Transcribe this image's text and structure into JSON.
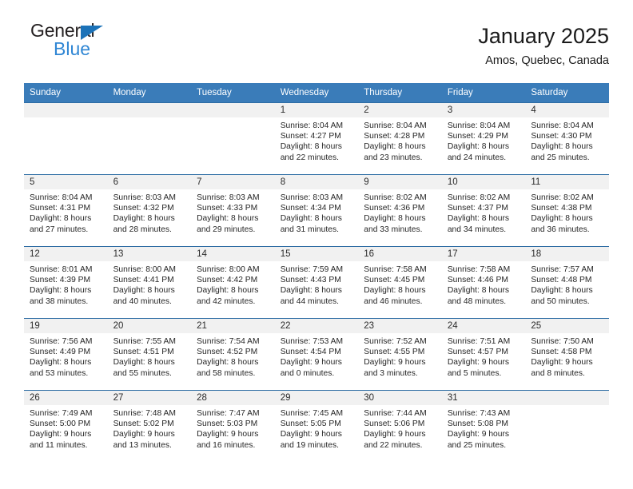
{
  "brand": {
    "name_top": "General",
    "name_bottom": "Blue",
    "triangle_color": "#1b72b8",
    "blue_text_color": "#2f86d4"
  },
  "header": {
    "title": "January 2025",
    "location": "Amos, Quebec, Canada"
  },
  "theme": {
    "header_bar_color": "#3a7cb9",
    "row_rule_color": "#2e6da4",
    "daystrip_color": "#f1f1f1"
  },
  "calendar": {
    "weekday_headers": [
      "Sunday",
      "Monday",
      "Tuesday",
      "Wednesday",
      "Thursday",
      "Friday",
      "Saturday"
    ],
    "labels": {
      "sunrise": "Sunrise:",
      "sunset": "Sunset:",
      "daylight": "Daylight:"
    },
    "weeks": [
      [
        {
          "blank": true
        },
        {
          "blank": true
        },
        {
          "blank": true
        },
        {
          "day": "1",
          "sunrise": "Sunrise: 8:04 AM",
          "sunset": "Sunset: 4:27 PM",
          "daylight_l1": "Daylight: 8 hours",
          "daylight_l2": "and 22 minutes."
        },
        {
          "day": "2",
          "sunrise": "Sunrise: 8:04 AM",
          "sunset": "Sunset: 4:28 PM",
          "daylight_l1": "Daylight: 8 hours",
          "daylight_l2": "and 23 minutes."
        },
        {
          "day": "3",
          "sunrise": "Sunrise: 8:04 AM",
          "sunset": "Sunset: 4:29 PM",
          "daylight_l1": "Daylight: 8 hours",
          "daylight_l2": "and 24 minutes."
        },
        {
          "day": "4",
          "sunrise": "Sunrise: 8:04 AM",
          "sunset": "Sunset: 4:30 PM",
          "daylight_l1": "Daylight: 8 hours",
          "daylight_l2": "and 25 minutes."
        }
      ],
      [
        {
          "day": "5",
          "sunrise": "Sunrise: 8:04 AM",
          "sunset": "Sunset: 4:31 PM",
          "daylight_l1": "Daylight: 8 hours",
          "daylight_l2": "and 27 minutes."
        },
        {
          "day": "6",
          "sunrise": "Sunrise: 8:03 AM",
          "sunset": "Sunset: 4:32 PM",
          "daylight_l1": "Daylight: 8 hours",
          "daylight_l2": "and 28 minutes."
        },
        {
          "day": "7",
          "sunrise": "Sunrise: 8:03 AM",
          "sunset": "Sunset: 4:33 PM",
          "daylight_l1": "Daylight: 8 hours",
          "daylight_l2": "and 29 minutes."
        },
        {
          "day": "8",
          "sunrise": "Sunrise: 8:03 AM",
          "sunset": "Sunset: 4:34 PM",
          "daylight_l1": "Daylight: 8 hours",
          "daylight_l2": "and 31 minutes."
        },
        {
          "day": "9",
          "sunrise": "Sunrise: 8:02 AM",
          "sunset": "Sunset: 4:36 PM",
          "daylight_l1": "Daylight: 8 hours",
          "daylight_l2": "and 33 minutes."
        },
        {
          "day": "10",
          "sunrise": "Sunrise: 8:02 AM",
          "sunset": "Sunset: 4:37 PM",
          "daylight_l1": "Daylight: 8 hours",
          "daylight_l2": "and 34 minutes."
        },
        {
          "day": "11",
          "sunrise": "Sunrise: 8:02 AM",
          "sunset": "Sunset: 4:38 PM",
          "daylight_l1": "Daylight: 8 hours",
          "daylight_l2": "and 36 minutes."
        }
      ],
      [
        {
          "day": "12",
          "sunrise": "Sunrise: 8:01 AM",
          "sunset": "Sunset: 4:39 PM",
          "daylight_l1": "Daylight: 8 hours",
          "daylight_l2": "and 38 minutes."
        },
        {
          "day": "13",
          "sunrise": "Sunrise: 8:00 AM",
          "sunset": "Sunset: 4:41 PM",
          "daylight_l1": "Daylight: 8 hours",
          "daylight_l2": "and 40 minutes."
        },
        {
          "day": "14",
          "sunrise": "Sunrise: 8:00 AM",
          "sunset": "Sunset: 4:42 PM",
          "daylight_l1": "Daylight: 8 hours",
          "daylight_l2": "and 42 minutes."
        },
        {
          "day": "15",
          "sunrise": "Sunrise: 7:59 AM",
          "sunset": "Sunset: 4:43 PM",
          "daylight_l1": "Daylight: 8 hours",
          "daylight_l2": "and 44 minutes."
        },
        {
          "day": "16",
          "sunrise": "Sunrise: 7:58 AM",
          "sunset": "Sunset: 4:45 PM",
          "daylight_l1": "Daylight: 8 hours",
          "daylight_l2": "and 46 minutes."
        },
        {
          "day": "17",
          "sunrise": "Sunrise: 7:58 AM",
          "sunset": "Sunset: 4:46 PM",
          "daylight_l1": "Daylight: 8 hours",
          "daylight_l2": "and 48 minutes."
        },
        {
          "day": "18",
          "sunrise": "Sunrise: 7:57 AM",
          "sunset": "Sunset: 4:48 PM",
          "daylight_l1": "Daylight: 8 hours",
          "daylight_l2": "and 50 minutes."
        }
      ],
      [
        {
          "day": "19",
          "sunrise": "Sunrise: 7:56 AM",
          "sunset": "Sunset: 4:49 PM",
          "daylight_l1": "Daylight: 8 hours",
          "daylight_l2": "and 53 minutes."
        },
        {
          "day": "20",
          "sunrise": "Sunrise: 7:55 AM",
          "sunset": "Sunset: 4:51 PM",
          "daylight_l1": "Daylight: 8 hours",
          "daylight_l2": "and 55 minutes."
        },
        {
          "day": "21",
          "sunrise": "Sunrise: 7:54 AM",
          "sunset": "Sunset: 4:52 PM",
          "daylight_l1": "Daylight: 8 hours",
          "daylight_l2": "and 58 minutes."
        },
        {
          "day": "22",
          "sunrise": "Sunrise: 7:53 AM",
          "sunset": "Sunset: 4:54 PM",
          "daylight_l1": "Daylight: 9 hours",
          "daylight_l2": "and 0 minutes."
        },
        {
          "day": "23",
          "sunrise": "Sunrise: 7:52 AM",
          "sunset": "Sunset: 4:55 PM",
          "daylight_l1": "Daylight: 9 hours",
          "daylight_l2": "and 3 minutes."
        },
        {
          "day": "24",
          "sunrise": "Sunrise: 7:51 AM",
          "sunset": "Sunset: 4:57 PM",
          "daylight_l1": "Daylight: 9 hours",
          "daylight_l2": "and 5 minutes."
        },
        {
          "day": "25",
          "sunrise": "Sunrise: 7:50 AM",
          "sunset": "Sunset: 4:58 PM",
          "daylight_l1": "Daylight: 9 hours",
          "daylight_l2": "and 8 minutes."
        }
      ],
      [
        {
          "day": "26",
          "sunrise": "Sunrise: 7:49 AM",
          "sunset": "Sunset: 5:00 PM",
          "daylight_l1": "Daylight: 9 hours",
          "daylight_l2": "and 11 minutes."
        },
        {
          "day": "27",
          "sunrise": "Sunrise: 7:48 AM",
          "sunset": "Sunset: 5:02 PM",
          "daylight_l1": "Daylight: 9 hours",
          "daylight_l2": "and 13 minutes."
        },
        {
          "day": "28",
          "sunrise": "Sunrise: 7:47 AM",
          "sunset": "Sunset: 5:03 PM",
          "daylight_l1": "Daylight: 9 hours",
          "daylight_l2": "and 16 minutes."
        },
        {
          "day": "29",
          "sunrise": "Sunrise: 7:45 AM",
          "sunset": "Sunset: 5:05 PM",
          "daylight_l1": "Daylight: 9 hours",
          "daylight_l2": "and 19 minutes."
        },
        {
          "day": "30",
          "sunrise": "Sunrise: 7:44 AM",
          "sunset": "Sunset: 5:06 PM",
          "daylight_l1": "Daylight: 9 hours",
          "daylight_l2": "and 22 minutes."
        },
        {
          "day": "31",
          "sunrise": "Sunrise: 7:43 AM",
          "sunset": "Sunset: 5:08 PM",
          "daylight_l1": "Daylight: 9 hours",
          "daylight_l2": "and 25 minutes."
        },
        {
          "blank": true
        }
      ]
    ]
  }
}
